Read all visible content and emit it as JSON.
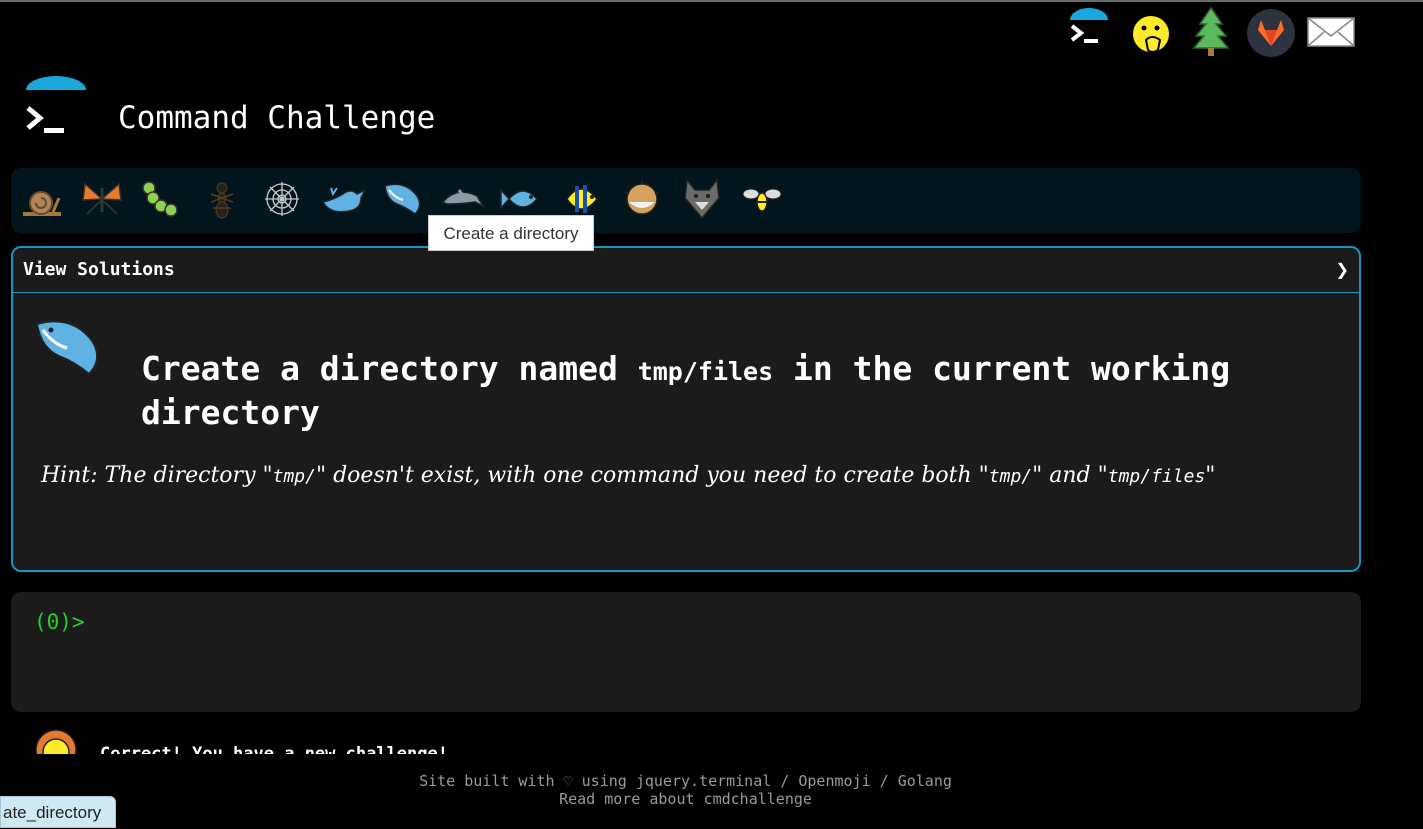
{
  "header": {
    "title": "Command Challenge"
  },
  "top_icons": [
    "terminal-icon",
    "face-with-hand-over-mouth-icon",
    "tree-icon",
    "gitlab-icon",
    "envelope-icon"
  ],
  "challenge_bar": {
    "icons": [
      "snail-icon",
      "butterfly-icon",
      "caterpillar-icon",
      "ant-icon",
      "spider-web-icon",
      "whale-icon",
      "orca-icon",
      "dolphin-icon",
      "fish-icon",
      "tropical-fish-icon",
      "blowfish-icon",
      "wolf-icon",
      "bee-icon"
    ],
    "tooltip": "Create a directory"
  },
  "panel": {
    "view_solutions": "View Solutions",
    "chevron": "❯",
    "title_pre": "Create a directory named ",
    "title_code": "tmp/files",
    "title_post": " in the current working directory",
    "hint_1": "Hint: The directory \"",
    "hint_code_1": "tmp/",
    "hint_2": "\" doesn't exist, with one command you need to create both \"",
    "hint_code_2": "tmp/",
    "hint_3": "\" and \"",
    "hint_code_3": "tmp/files",
    "hint_4": "\""
  },
  "terminal": {
    "prompt": "(0)>"
  },
  "feedback": {
    "text": "Correct! You have a new challenge!"
  },
  "footer": {
    "line1": "Site built with ♡ using jquery.terminal / Openmoji / Golang",
    "line2": "Read more about cmdchallenge"
  },
  "status_bar": {
    "text": "ate_directory"
  },
  "colors": {
    "accent": "#1a95c2",
    "prompt": "#26d126",
    "bar_bg": "#02151c",
    "panel_bg": "#1b1b1b"
  }
}
